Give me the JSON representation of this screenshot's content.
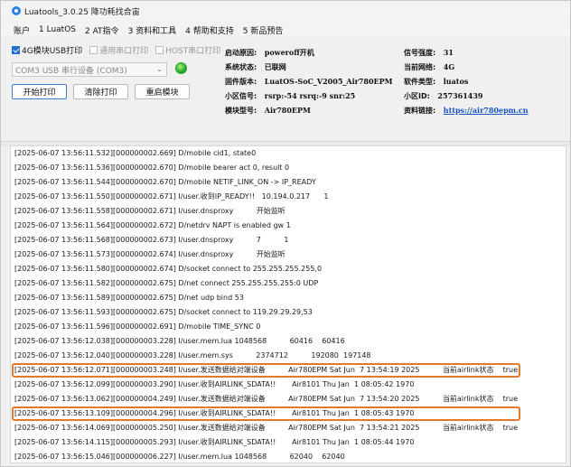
{
  "window": {
    "title": "Luatools_3.0.25 降功耗找合宙"
  },
  "menu": [
    "账户",
    "1 LuatOS",
    "2 AT指令",
    "3 资料和工具",
    "4 帮助和支持",
    "5 新品预告"
  ],
  "options": {
    "chk_4g_usb": "4G模块USB打印",
    "chk_serial": "通用串口打印",
    "chk_host": "HOST串口打印"
  },
  "port": {
    "selected": "COM3 USB 串行设备 (COM3)",
    "status_color": "#2aa82a"
  },
  "buttons": {
    "start": "开始打印",
    "clear": "清除打印",
    "reboot": "重启模块"
  },
  "info": {
    "left": [
      {
        "label": "启动原因:",
        "value": "poweroff开机"
      },
      {
        "label": "系统状态:",
        "value": "已联网"
      },
      {
        "label": "固件版本:",
        "value": "LuatOS-SoC_V2005_Air780EPM"
      },
      {
        "label": "小区信号:",
        "value": "rsrp:-54 rsrq:-9 snr:25"
      },
      {
        "label": "模块型号:",
        "value": "Air780EPM"
      }
    ],
    "right": [
      {
        "label": "信号强度:",
        "value": "31"
      },
      {
        "label": "当前网络:",
        "value": "4G"
      },
      {
        "label": "软件类型:",
        "value": "luatos"
      },
      {
        "label": "小区ID:",
        "value": "257361439"
      },
      {
        "label": "资料链接:",
        "value": "https://air780epm.cn"
      }
    ]
  },
  "log": [
    "[2025-06-07 13:56:11.532][000000002.669] D/mobile cid1, state0",
    "[2025-06-07 13:56:11.536][000000002.670] D/mobile bearer act 0, result 0",
    "[2025-06-07 13:56:11.544][000000002.670] D/mobile NETIF_LINK_ON -> IP_READY",
    "[2025-06-07 13:56:11.550][000000002.671] I/user.收到IP_READY!!   10.194.0.217      1",
    "[2025-06-07 13:56:11.558][000000002.671] I/user.dnsproxy          开始监听",
    "[2025-06-07 13:56:11.564][000000002.672] D/netdrv NAPT is enabled gw 1",
    "[2025-06-07 13:56:11.568][000000002.673] I/user.dnsproxy          7          1",
    "[2025-06-07 13:56:11.573][000000002.674] I/user.dnsproxy          开始监听",
    "[2025-06-07 13:56:11.580][000000002.674] D/socket connect to 255.255.255.255,0",
    "[2025-06-07 13:56:11.582][000000002.675] D/net connect 255.255.255.255:0 UDP",
    "[2025-06-07 13:56:11.589][000000002.675] D/net udp bind 53",
    "[2025-06-07 13:56:11.593][000000002.675] D/socket connect to 119.29.29.29,53",
    "[2025-06-07 13:56:11.596][000000002.691] D/mobile TIME_SYNC 0",
    "[2025-06-07 13:56:12.038][000000003.228] I/user.mem.lua 1048568          60416    60416",
    "[2025-06-07 13:56:12.040][000000003.228] I/user.mem.sys          2374712          192080  197148",
    "[2025-06-07 13:56:12.071][000000003.248] I/user.发送数据给对端设备          Air780EPM Sat Jun  7 13:54:19 2025          当前airlink状态    true",
    "[2025-06-07 13:56:12.099][000000003.290] I/user.收到AIRLINK_SDATA!!       Air8101 Thu Jan  1 08:05:42 1970",
    "[2025-06-07 13:56:13.062][000000004.249] I/user.发送数据给对端设备          Air780EPM Sat Jun  7 13:54:20 2025          当前airlink状态    true",
    "[2025-06-07 13:56:13.109][000000004.296] I/user.收到AIRLINK_SDATA!!       Air8101 Thu Jan  1 08:05:43 1970",
    "[2025-06-07 13:56:14.069][000000005.250] I/user.发送数据给对端设备          Air780EPM Sat Jun  7 13:54:21 2025          当前airlink状态    true",
    "[2025-06-07 13:56:14.115][000000005.293] I/user.收到AIRLINK_SDATA!!       Air8101 Thu Jan  1 08:05:44 1970",
    "[2025-06-07 13:56:15.046][000000006.227] I/user.mem.lua 1048568          62040    62040"
  ],
  "highlight_color": "#e37a2b"
}
